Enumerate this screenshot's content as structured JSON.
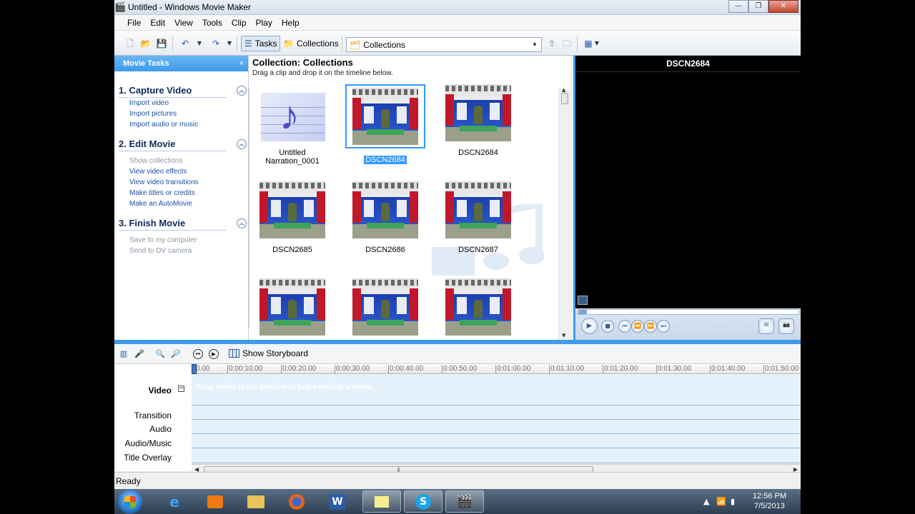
{
  "window": {
    "title": "Untitled - Windows Movie Maker",
    "buttons": {
      "minimize": "—",
      "maximize": "❐",
      "close": "✕"
    }
  },
  "menu": [
    "File",
    "Edit",
    "View",
    "Tools",
    "Clip",
    "Play",
    "Help"
  ],
  "toolbar": {
    "tasks_label": "Tasks",
    "collections_label": "Collections",
    "collections_combo_value": "Collections"
  },
  "task_pane": {
    "header": "Movie Tasks",
    "close": "×",
    "sections": [
      {
        "title": "1. Capture Video",
        "links": [
          {
            "label": "Import video",
            "enabled": true
          },
          {
            "label": "Import pictures",
            "enabled": true
          },
          {
            "label": "Import audio or music",
            "enabled": true
          }
        ]
      },
      {
        "title": "2. Edit Movie",
        "links": [
          {
            "label": "Show collections",
            "enabled": false
          },
          {
            "label": "View video effects",
            "enabled": true
          },
          {
            "label": "View video transitions",
            "enabled": true
          },
          {
            "label": "Make titles or credits",
            "enabled": true
          },
          {
            "label": "Make an AutoMovie",
            "enabled": true
          }
        ]
      },
      {
        "title": "3. Finish Movie",
        "links": [
          {
            "label": "Save to my computer",
            "enabled": false
          },
          {
            "label": "Send to DV camera",
            "enabled": false
          }
        ]
      }
    ]
  },
  "collection": {
    "title": "Collection: Collections",
    "subtitle": "Drag a clip and drop it on the timeline below.",
    "clips": [
      {
        "label": "Untitled Narration_0001",
        "kind": "audio",
        "selected": false
      },
      {
        "label": "DSCN2684",
        "kind": "video",
        "selected": true
      },
      {
        "label": "DSCN2684",
        "kind": "video",
        "selected": false
      },
      {
        "label": "DSCN2685",
        "kind": "video",
        "selected": false
      },
      {
        "label": "DSCN2686",
        "kind": "video",
        "selected": false
      },
      {
        "label": "DSCN2687",
        "kind": "video",
        "selected": false
      },
      {
        "label": "",
        "kind": "video",
        "selected": false
      },
      {
        "label": "",
        "kind": "video",
        "selected": false
      },
      {
        "label": "",
        "kind": "video",
        "selected": false
      }
    ]
  },
  "monitor": {
    "title": "DSCN2684",
    "seek_position": 0
  },
  "timeline": {
    "storyboard_label": "Show Storyboard",
    "ruler": [
      "0.00",
      "0:00:10.00",
      "0:00:20.00",
      "0:00:30.00",
      "0:00:40.00",
      "0:00:50.00",
      "0:01:00.00",
      "0:01:10.00",
      "0:01:20.00",
      "0:01:30.00",
      "0:01:40.00",
      "0:01:50.00"
    ],
    "tracks": {
      "video": "Video",
      "transition": "Transition",
      "audio": "Audio",
      "audio_music": "Audio/Music",
      "title_overlay": "Title Overlay"
    },
    "drag_hint": "Drag media to the timeline to begin making a movie."
  },
  "status": "Ready",
  "taskbar": {
    "time": "12:56 PM",
    "date": "7/5/2013",
    "apps": [
      "ie",
      "media-player",
      "explorer",
      "firefox",
      "word",
      "sticky-notes",
      "skype",
      "movie-maker"
    ]
  },
  "colors": {
    "accent": "#3d9be9",
    "selection": "#3399ff",
    "link": "#1c4fa8"
  }
}
